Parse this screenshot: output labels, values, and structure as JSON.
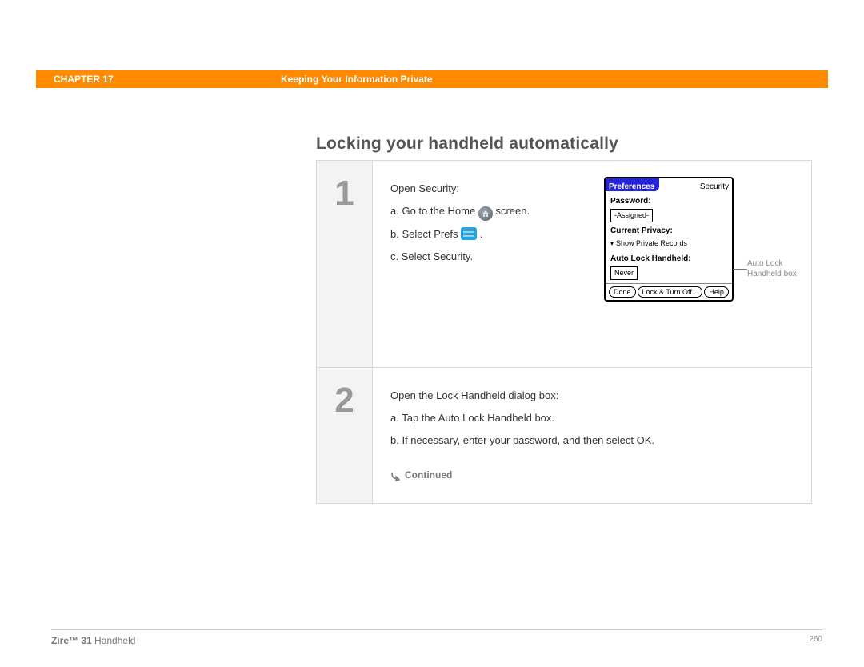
{
  "header": {
    "chapter": "CHAPTER 17",
    "title": "Keeping Your Information Private"
  },
  "section_heading": "Locking your handheld automatically",
  "steps": [
    {
      "num": "1",
      "intro": "Open Security:",
      "sub_a_pre": "a.  Go to the Home ",
      "sub_a_post": " screen.",
      "sub_b_pre": "b.  Select Prefs ",
      "sub_b_post": ".",
      "sub_c": "c.  Select Security.",
      "callout": "Auto Lock Handheld box"
    },
    {
      "num": "2",
      "intro": "Open the Lock Handheld dialog box:",
      "sub_a": "a.  Tap the Auto Lock Handheld box.",
      "sub_b": "b.  If necessary, enter your password, and then select OK."
    }
  ],
  "palm_screen": {
    "title_left": "Preferences",
    "title_right": "Security",
    "password_label": "Password:",
    "password_value": "-Assigned-",
    "privacy_label": "Current Privacy:",
    "privacy_value": "Show Private Records",
    "autolock_label": "Auto Lock Handheld:",
    "autolock_value": "Never",
    "btn_done": "Done",
    "btn_lock": "Lock & Turn Off...",
    "btn_help": "Help"
  },
  "continued": "Continued",
  "footer": {
    "product_bold": "Zire™ 31",
    "product_rest": " Handheld",
    "page": "260"
  }
}
